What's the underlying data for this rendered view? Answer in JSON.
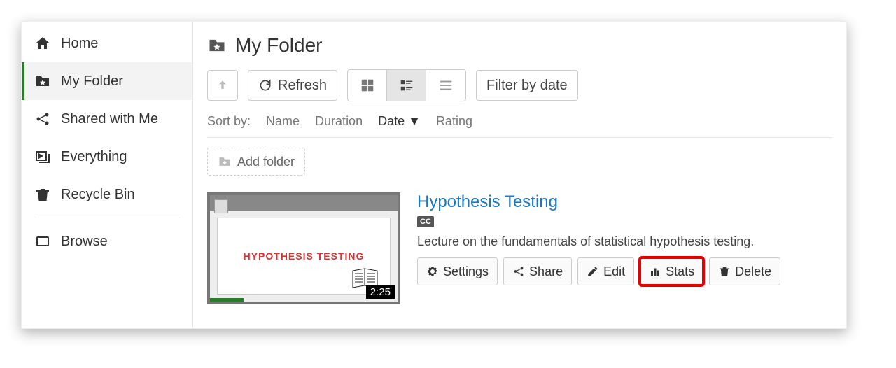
{
  "sidebar": {
    "items": [
      {
        "label": "Home"
      },
      {
        "label": "My Folder"
      },
      {
        "label": "Shared with Me"
      },
      {
        "label": "Everything"
      },
      {
        "label": "Recycle Bin"
      },
      {
        "label": "Browse"
      }
    ]
  },
  "header": {
    "title": "My Folder"
  },
  "toolbar": {
    "refresh": "Refresh",
    "filter": "Filter by date"
  },
  "sort": {
    "label": "Sort by:",
    "name": "Name",
    "duration": "Duration",
    "date": "Date ▼",
    "rating": "Rating"
  },
  "addfolder": "Add folder",
  "item": {
    "title": "Hypothesis Testing",
    "thumb_text": "HYPOTHESIS TESTING",
    "cc": "CC",
    "description": "Lecture on the fundamentals of statistical hypothesis testing.",
    "duration": "2:25",
    "buttons": {
      "settings": "Settings",
      "share": "Share",
      "edit": "Edit",
      "stats": "Stats",
      "delete": "Delete"
    }
  }
}
